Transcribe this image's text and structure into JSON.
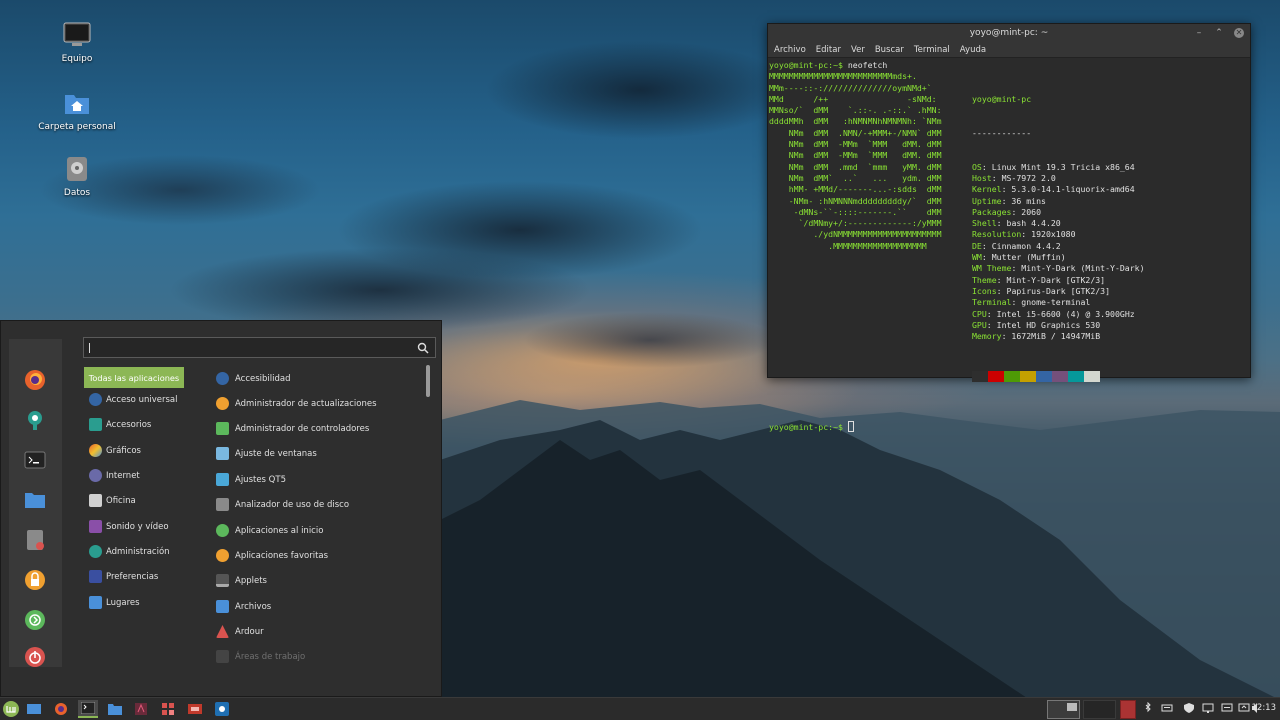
{
  "desktop": {
    "icons": [
      {
        "label": "Equipo",
        "icon": "computer-icon"
      },
      {
        "label": "Carpeta personal",
        "icon": "home-folder-icon"
      },
      {
        "label": "Datos",
        "icon": "drive-icon"
      }
    ]
  },
  "terminal": {
    "title": "yoyo@mint-pc: ~",
    "controls": [
      "minimize",
      "maximize",
      "close"
    ],
    "menu": [
      "Archivo",
      "Editar",
      "Ver",
      "Buscar",
      "Terminal",
      "Ayuda"
    ],
    "command_line": {
      "prompt": "yoyo@mint-pc:~$",
      "command": " neofetch"
    },
    "logo_lines": [
      "MMMMMMMMMMMMMMMMMMMMMMMMMmds+.",
      "MMm----::-://////////////oymNMd+`",
      "MMd      /++                -sNMd:",
      "MMNso/`  dMM    `.::-. .-::.` .hMN:",
      "ddddMMh  dMM   :hNMNMNhNMNMNh: `NMm",
      "    NMm  dMM  .NMN/-+MMM+-/NMN` dMM",
      "    NMm  dMM  -MMm  `MMM   dMM. dMM",
      "    NMm  dMM  -MMm  `MMM   dMM. dMM",
      "    NMm  dMM  .mmd  `mmm   yMM. dMM",
      "    NMm  dMM`  ..`   ...   ydm. dMM",
      "    hMM- +MMd/-------...-:sdds  dMM",
      "    -NMm- :hNMNNNmdddddddddy/`  dMM",
      "     -dMNs-``-::::-------.``    dMM",
      "      `/dMNmy+/:-------------:/yMMM",
      "         ./ydNMMMMMMMMMMMMMMMMMMMMM",
      "            .MMMMMMMMMMMMMMMMMMM"
    ],
    "user_host": "yoyo@mint-pc",
    "separator": "------------",
    "info": [
      {
        "key": "OS",
        "value": "Linux Mint 19.3 Tricia x86_64"
      },
      {
        "key": "Host",
        "value": "MS-7972 2.0"
      },
      {
        "key": "Kernel",
        "value": "5.3.0-14.1-liquorix-amd64"
      },
      {
        "key": "Uptime",
        "value": "36 mins"
      },
      {
        "key": "Packages",
        "value": "2060"
      },
      {
        "key": "Shell",
        "value": "bash 4.4.20"
      },
      {
        "key": "Resolution",
        "value": "1920x1080"
      },
      {
        "key": "DE",
        "value": "Cinnamon 4.4.2"
      },
      {
        "key": "WM",
        "value": "Mutter (Muffin)"
      },
      {
        "key": "WM Theme",
        "value": "Mint-Y-Dark (Mint-Y-Dark)"
      },
      {
        "key": "Theme",
        "value": "Mint-Y-Dark [GTK2/3]"
      },
      {
        "key": "Icons",
        "value": "Papirus-Dark [GTK2/3]"
      },
      {
        "key": "Terminal",
        "value": "gnome-terminal"
      },
      {
        "key": "CPU",
        "value": "Intel i5-6600 (4) @ 3.900GHz"
      },
      {
        "key": "GPU",
        "value": "Intel HD Graphics 530"
      },
      {
        "key": "Memory",
        "value": "1672MiB / 14947MiB"
      }
    ],
    "palette": [
      "#2e2e2e",
      "#cc0000",
      "#4e9a06",
      "#c4a000",
      "#3465a4",
      "#75507b",
      "#06989a",
      "#d3d7cf"
    ],
    "final_prompt": "yoyo@mint-pc:~$"
  },
  "menu": {
    "search_value": "",
    "favorites": [
      "firefox-icon",
      "mintinstall-icon",
      "terminal-icon",
      "files-icon",
      "disk-usage-icon",
      "lock-screen-icon",
      "logout-icon",
      "shutdown-icon"
    ],
    "categories": [
      {
        "label": "Todas las aplicaciones",
        "icon": "all-apps-icon"
      },
      {
        "label": "Acceso universal",
        "icon": "accessibility-icon"
      },
      {
        "label": "Accesorios",
        "icon": "accessories-icon"
      },
      {
        "label": "Gráficos",
        "icon": "graphics-icon"
      },
      {
        "label": "Internet",
        "icon": "internet-icon"
      },
      {
        "label": "Oficina",
        "icon": "office-icon"
      },
      {
        "label": "Sonido y vídeo",
        "icon": "multimedia-icon"
      },
      {
        "label": "Administración",
        "icon": "administration-icon"
      },
      {
        "label": "Preferencias",
        "icon": "preferences-icon"
      },
      {
        "label": "Lugares",
        "icon": "places-icon"
      }
    ],
    "apps": [
      {
        "label": "Accesibilidad",
        "icon": "accessibility-icon"
      },
      {
        "label": "Administrador de actualizaciones",
        "icon": "update-manager-icon"
      },
      {
        "label": "Administrador de controladores",
        "icon": "driver-manager-icon"
      },
      {
        "label": "Ajuste de ventanas",
        "icon": "window-settings-icon"
      },
      {
        "label": "Ajustes QT5",
        "icon": "qt5-settings-icon"
      },
      {
        "label": "Analizador de uso de disco",
        "icon": "disk-usage-icon"
      },
      {
        "label": "Aplicaciones al inicio",
        "icon": "startup-apps-icon"
      },
      {
        "label": "Aplicaciones favoritas",
        "icon": "favorite-apps-icon"
      },
      {
        "label": "Applets",
        "icon": "applets-icon"
      },
      {
        "label": "Archivos",
        "icon": "files-icon"
      },
      {
        "label": "Ardour",
        "icon": "ardour-icon"
      },
      {
        "label": "Áreas de trabajo",
        "icon": "workspaces-icon"
      }
    ]
  },
  "taskbar": {
    "launchers": [
      "mint-menu-icon",
      "show-desktop-icon",
      "firefox-icon",
      "terminal-icon",
      "files-icon",
      "app-a-icon",
      "app-b-icon",
      "app-c-icon",
      "app-d-icon"
    ],
    "tray": [
      "bluetooth-icon",
      "keyboard-icon",
      "shield-icon",
      "display-icon",
      "notifications-icon",
      "network-icon",
      "volume-icon"
    ],
    "clock": "12:13"
  },
  "colors": {
    "mint_green": "#8cb755",
    "terminal_green": "#8ae234"
  }
}
